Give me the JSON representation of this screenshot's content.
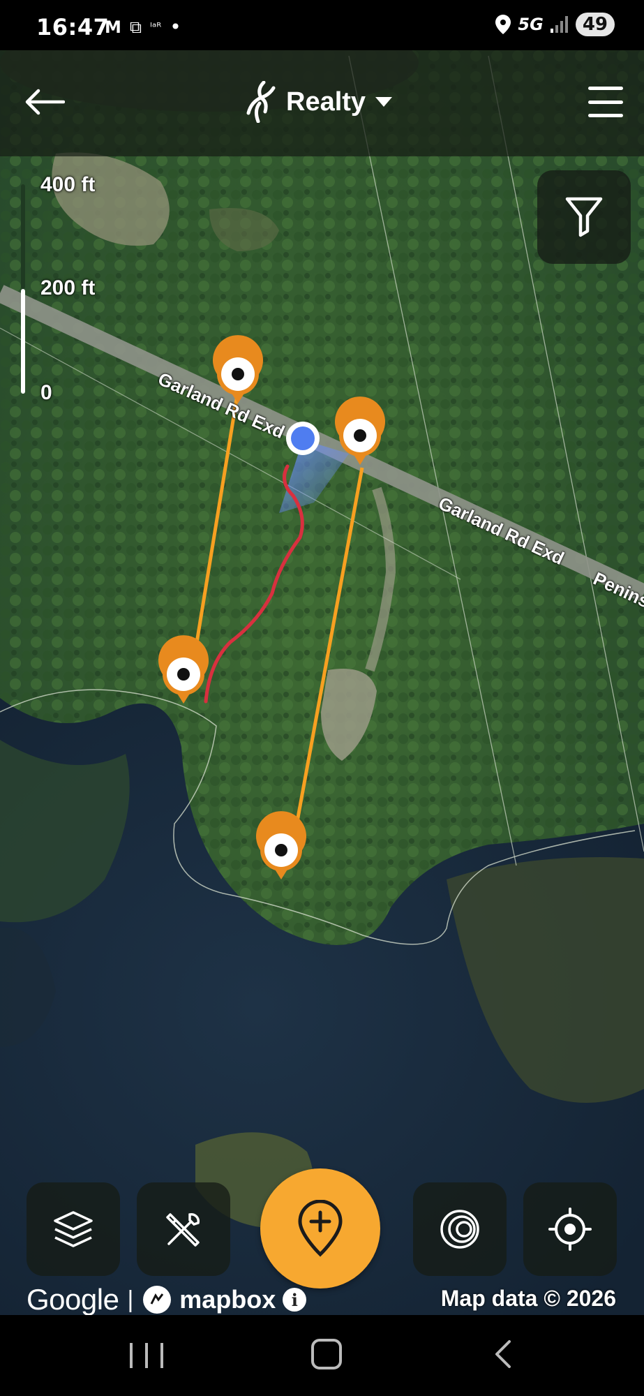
{
  "status_bar": {
    "time": "16:47",
    "icons_left": [
      "gmail-icon",
      "screenshot-icon",
      "lar-icon",
      "dot-icon"
    ],
    "icons_left_glyphs": [
      "M",
      "⧉",
      "ᴵᵃᴿ",
      "•"
    ],
    "network": "5G",
    "battery": "49"
  },
  "header": {
    "title": "Realty",
    "back_icon": "arrow-left-icon",
    "menu_icon": "hamburger-menu-icon",
    "logo_icon": "onx-logo-icon"
  },
  "map": {
    "scale": {
      "top": "400 ft",
      "middle": "200 ft",
      "bottom": "0"
    },
    "road_labels": [
      "Garland Rd Exd",
      "Garland Rd Exd",
      "Penins"
    ],
    "colors": {
      "boundary_line": "#f7a021",
      "marker": "#e88a1e",
      "track": "#d8303f",
      "location_dot": "#4f7df0",
      "heading_cone": "#5a7fe8"
    }
  },
  "controls": {
    "filter_icon": "filter-funnel-icon",
    "layers_icon": "layers-icon",
    "tools_icon": "tools-icon",
    "add_icon": "add-waypoint-icon",
    "rings_icon": "radar-rings-icon",
    "locate_icon": "crosshair-locate-icon",
    "add_button_color": "#f7a830"
  },
  "attribution": {
    "google": "Google",
    "separator": "|",
    "mapbox": "mapbox",
    "info": "i",
    "map_data": "Map data © 2026"
  },
  "nav_bar": {
    "icons": [
      "recents-icon",
      "home-icon",
      "back-icon"
    ]
  }
}
